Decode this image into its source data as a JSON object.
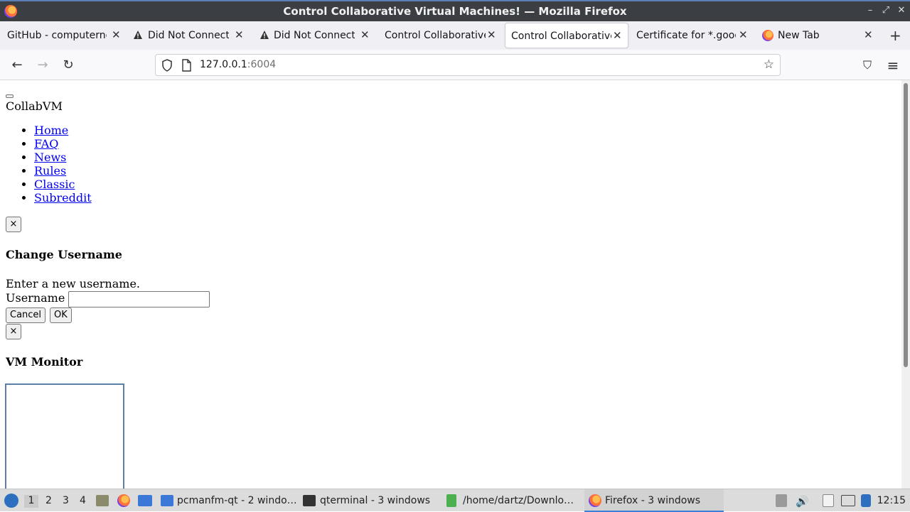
{
  "window": {
    "title": "Control Collaborative Virtual Machines! — Mozilla Firefox",
    "minimize": "–",
    "maximize": "⤢",
    "close": "✕"
  },
  "tabs": [
    {
      "label": "GitHub - computerne",
      "icon": "none",
      "active": false
    },
    {
      "label": "Did Not Connect: P",
      "icon": "warning-icon",
      "active": false
    },
    {
      "label": "Did Not Connect: P",
      "icon": "warning-icon",
      "active": false
    },
    {
      "label": "Control Collaborative",
      "icon": "none",
      "active": false
    },
    {
      "label": "Control Collaborative",
      "icon": "none",
      "active": true
    },
    {
      "label": "Certificate for *.goog",
      "icon": "none",
      "active": false
    },
    {
      "label": "New Tab",
      "icon": "firefox-icon",
      "active": false
    }
  ],
  "tab_close": "✕",
  "new_tab": "+",
  "nav": {
    "back": "←",
    "forward": "→",
    "reload": "↻",
    "url_host": "127.0.0.1",
    "url_port": ":6004",
    "star": "☆",
    "pocket": "⛉",
    "menu": "≡"
  },
  "page": {
    "brand": "CollabVM",
    "links": [
      "Home",
      "FAQ",
      "News",
      "Rules",
      "Classic",
      "Subreddit"
    ],
    "close_x": "×",
    "change_username": {
      "heading": "Change Username",
      "prompt": "Enter a new username.",
      "label": "Username",
      "value": "",
      "cancel": "Cancel",
      "ok": "OK"
    },
    "vm_monitor_heading": "VM Monitor"
  },
  "taskbar": {
    "workspaces": [
      "1",
      "2",
      "3",
      "4"
    ],
    "active_workspace": "1",
    "items": [
      {
        "label": "pcmanfm-qt - 2 windo…",
        "icon": "folder-icon"
      },
      {
        "label": "qterminal - 3 windows",
        "icon": "terminal-icon"
      },
      {
        "label": "/home/dartz/Downlo…",
        "icon": "archive-icon"
      },
      {
        "label": "Firefox - 3 windows",
        "icon": "firefox-icon",
        "active": true
      }
    ],
    "clock": "12:15"
  },
  "colors": {
    "titlebar": "#3b3f44",
    "tabstrip": "#f0f0f4",
    "link": "#0000ee",
    "taskbar": "#dcdcdc",
    "active_indicator": "#3b7fd8"
  }
}
